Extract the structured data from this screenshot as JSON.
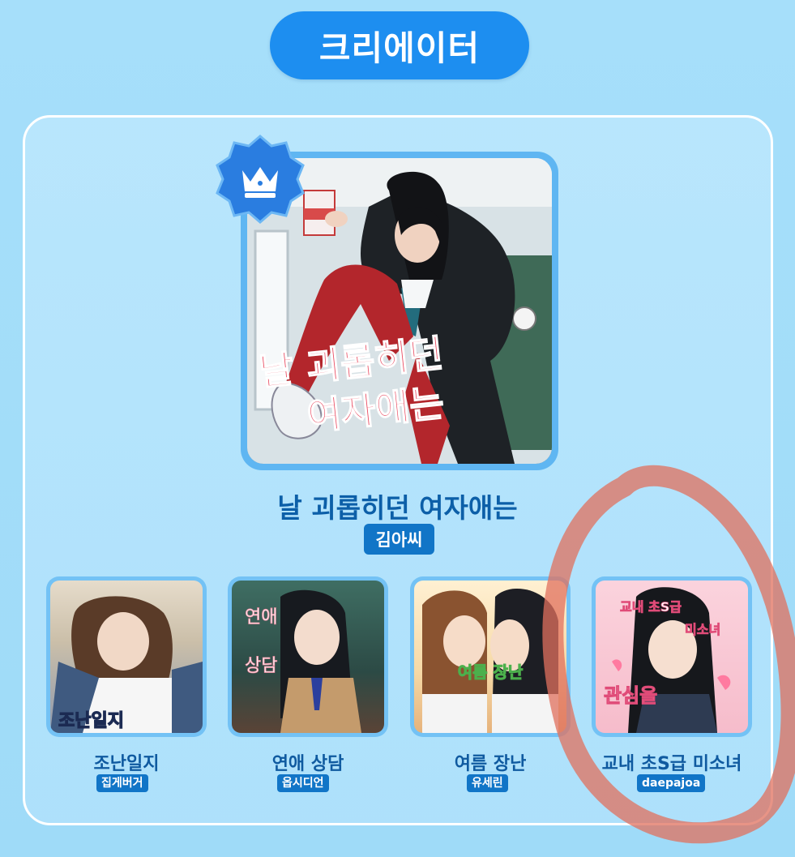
{
  "section": {
    "title": "크리에이터"
  },
  "featured": {
    "cover_text_line1": "날 괴롭히던",
    "cover_text_line2": "여자애는",
    "title": "날 괴롭히던 여자애는",
    "author": "김아씨",
    "badge_icon": "crown-icon"
  },
  "works": [
    {
      "title": "조난일지",
      "author": "집게버거",
      "cover_text": "조난일지"
    },
    {
      "title": "연애 상담",
      "author": "옵시디언",
      "cover_text_1": "연애",
      "cover_text_2": "상담"
    },
    {
      "title": "여름 장난",
      "author": "유세린",
      "cover_text": "여름 장난"
    },
    {
      "title": "교내 초S급 미소녀",
      "author": "daepajoa",
      "cover_text_1": "교내 초S급",
      "cover_text_2": "미소녀",
      "cover_text_3": "관심을"
    }
  ],
  "colors": {
    "accent": "#1d8ef0",
    "tag": "#1175c7",
    "title": "#0c5fa8",
    "annotation": "#e0705e"
  }
}
